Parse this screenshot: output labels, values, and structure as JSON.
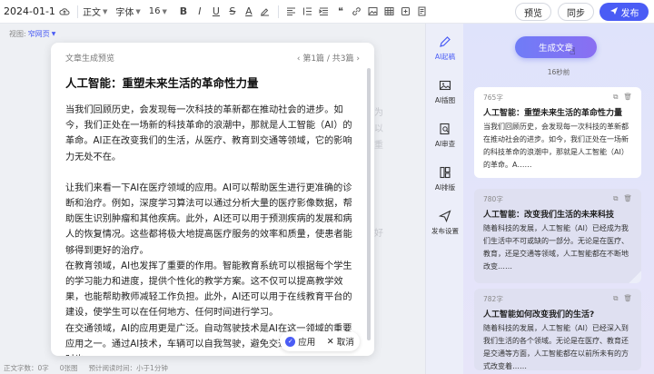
{
  "toolbar": {
    "doc_title": "2024-01-11...",
    "style_select": "正文",
    "font_select": "字体",
    "size_select": "16",
    "preview_label": "预览",
    "sync_label": "同步",
    "publish_label": "发布"
  },
  "view": {
    "label": "视图:",
    "value": "窄网页"
  },
  "editor_bg": {
    "lines": [
      "为",
      "以",
      "重",
      "好"
    ]
  },
  "modal": {
    "header": "文章生成预览",
    "pager": "第1篇 / 共3篇",
    "title": "人工智能：重塑未来生活的革命性力量",
    "paragraphs": [
      "当我们回顾历史，会发现每一次科技的革新都在推动社会的进步。如今，我们正处在一场新的科技革命的浪潮中，那就是人工智能（AI）的革命。AI正在改变我们的生活，从医疗、教育到交通等领域，它的影响力无处不在。",
      "让我们来看一下AI在医疗领域的应用。AI可以帮助医生进行更准确的诊断和治疗。例如，深度学习算法可以通过分析大量的医疗影像数据，帮助医生识别肿瘤和其他疾病。此外，AI还可以用于预测疾病的发展和病人的恢复情况。这些都将极大地提高医疗服务的效率和质量，使患者能够得到更好的治疗。",
      "在教育领域，AI也发挥了重要的作用。智能教育系统可以根据每个学生的学习能力和进度，提供个性化的教学方案。这不仅可以提高教学效果，也能帮助教师减轻工作负担。此外，AI还可以用于在线教育平台的建设，使学生可以在任何地方、任何时间进行学习。",
      "在交通领域，AI的应用更是广泛。自动驾驶技术是AI在这一领域的重要应用之一。通过AI技术，车辆可以自我驾驶，避免交通事故的发生，同时也"
    ],
    "apply_label": "应用",
    "cancel_label": "取消"
  },
  "statusbar": {
    "word_count": "正文字数：0字",
    "image_count": "0张图",
    "read_time": "预计阅读时间：小于1分钟"
  },
  "side_nav": {
    "items": [
      {
        "label": "AI起稿",
        "icon": "pen-icon"
      },
      {
        "label": "AI插图",
        "icon": "image-icon"
      },
      {
        "label": "AI审查",
        "icon": "review-icon"
      },
      {
        "label": "AI排版",
        "icon": "layout-icon"
      },
      {
        "label": "发布设置",
        "icon": "send-icon"
      }
    ]
  },
  "panel": {
    "generate_label": "生成文章",
    "time_label": "16秒前",
    "cards": [
      {
        "count": "765字",
        "title": "人工智能：重塑未来生活的革命性力量",
        "text": "当我们回顾历史，会发现每一次科技的革新都在推动社会的进步。如今，我们正处在一场新的科技革命的浪潮中，那就是人工智能（AI）的革命。A……"
      },
      {
        "count": "780字",
        "title": "人工智能：改变我们生活的未来科技",
        "text": "随着科技的发展，人工智能（AI）已经成为我们生活中不可或缺的一部分。无论是在医疗、教育，还是交通等领域，人工智能都在不断地改变……"
      },
      {
        "count": "782字",
        "title": "人工智能如何改变我们的生活?",
        "text": "随着科技的发展，人工智能（AI）已经深入到我们生活的各个领域。无论是在医疗、教育还是交通等方面，人工智能都在以前所未有的方式改变着……"
      }
    ]
  },
  "colors": {
    "accent": "#4a5cf5"
  }
}
